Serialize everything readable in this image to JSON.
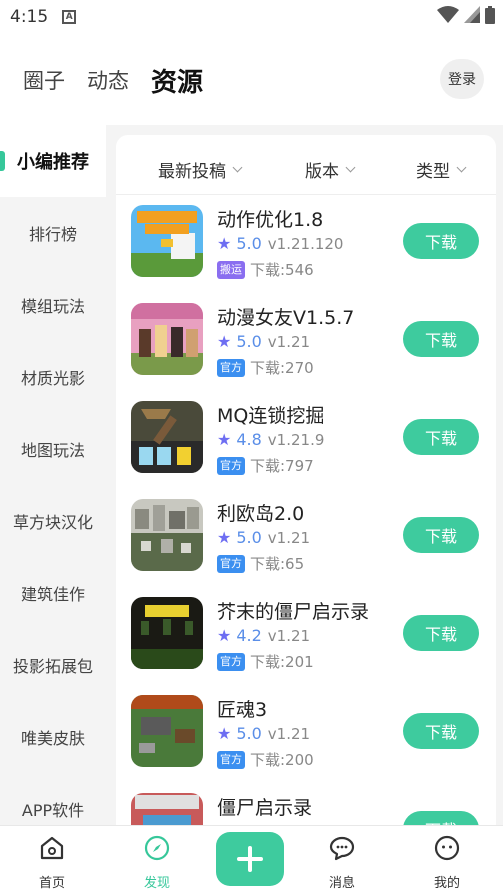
{
  "status_bar": {
    "time": "4:15",
    "notif_icon": "A"
  },
  "top_tabs": [
    "圈子",
    "动态",
    "资源"
  ],
  "login_label": "登录",
  "left_nav": [
    "小编推荐",
    "排行榜",
    "模组玩法",
    "材质光影",
    "地图玩法",
    "草方块汉化",
    "建筑佳作",
    "投影拓展包",
    "唯美皮肤",
    "APP软件"
  ],
  "filters": [
    "最新投稿",
    "版本",
    "类型"
  ],
  "download_label": "下载",
  "star_glyph": "★",
  "apps": [
    {
      "title": "动作优化1.8",
      "rating": "5.0",
      "version": "v1.21.120",
      "tag": "搬运",
      "tag_color": "#8a6ef0",
      "downloads": "下载:546",
      "icon_text": "ACTIONS & STUFF"
    },
    {
      "title": "动漫女友V1.5.7",
      "rating": "5.0",
      "version": "v1.21",
      "tag": "官方",
      "tag_color": "#3b8ff0",
      "downloads": "下载:270",
      "icon_text": ""
    },
    {
      "title": "MQ连锁挖掘",
      "rating": "4.8",
      "version": "v1.21.9",
      "tag": "官方",
      "tag_color": "#3b8ff0",
      "downloads": "下载:797",
      "icon_text": "MQ"
    },
    {
      "title": "利欧岛2.0",
      "rating": "5.0",
      "version": "v1.21",
      "tag": "官方",
      "tag_color": "#3b8ff0",
      "downloads": "下载:65",
      "icon_text": "利欧市2.0"
    },
    {
      "title": "芥末的僵尸启示录",
      "rating": "4.2",
      "version": "v1.21",
      "tag": "官方",
      "tag_color": "#3b8ff0",
      "downloads": "下载:201",
      "icon_text": "MUSTARD VIRUS"
    },
    {
      "title": "匠魂3",
      "rating": "5.0",
      "version": "v1.21",
      "tag": "官方",
      "tag_color": "#3b8ff0",
      "downloads": "下载:200",
      "icon_text": "kers' Const"
    },
    {
      "title": "僵尸启示录",
      "rating": "",
      "version": "",
      "tag": "",
      "tag_color": "#3b8ff0",
      "downloads": "",
      "icon_text": "MINECRAFT"
    }
  ],
  "bottom_nav": [
    "首页",
    "发现",
    "消息",
    "我的"
  ],
  "colors": {
    "accent": "#3ecb9e",
    "star": "#6e6ef2",
    "rating": "#5a8ee8"
  }
}
